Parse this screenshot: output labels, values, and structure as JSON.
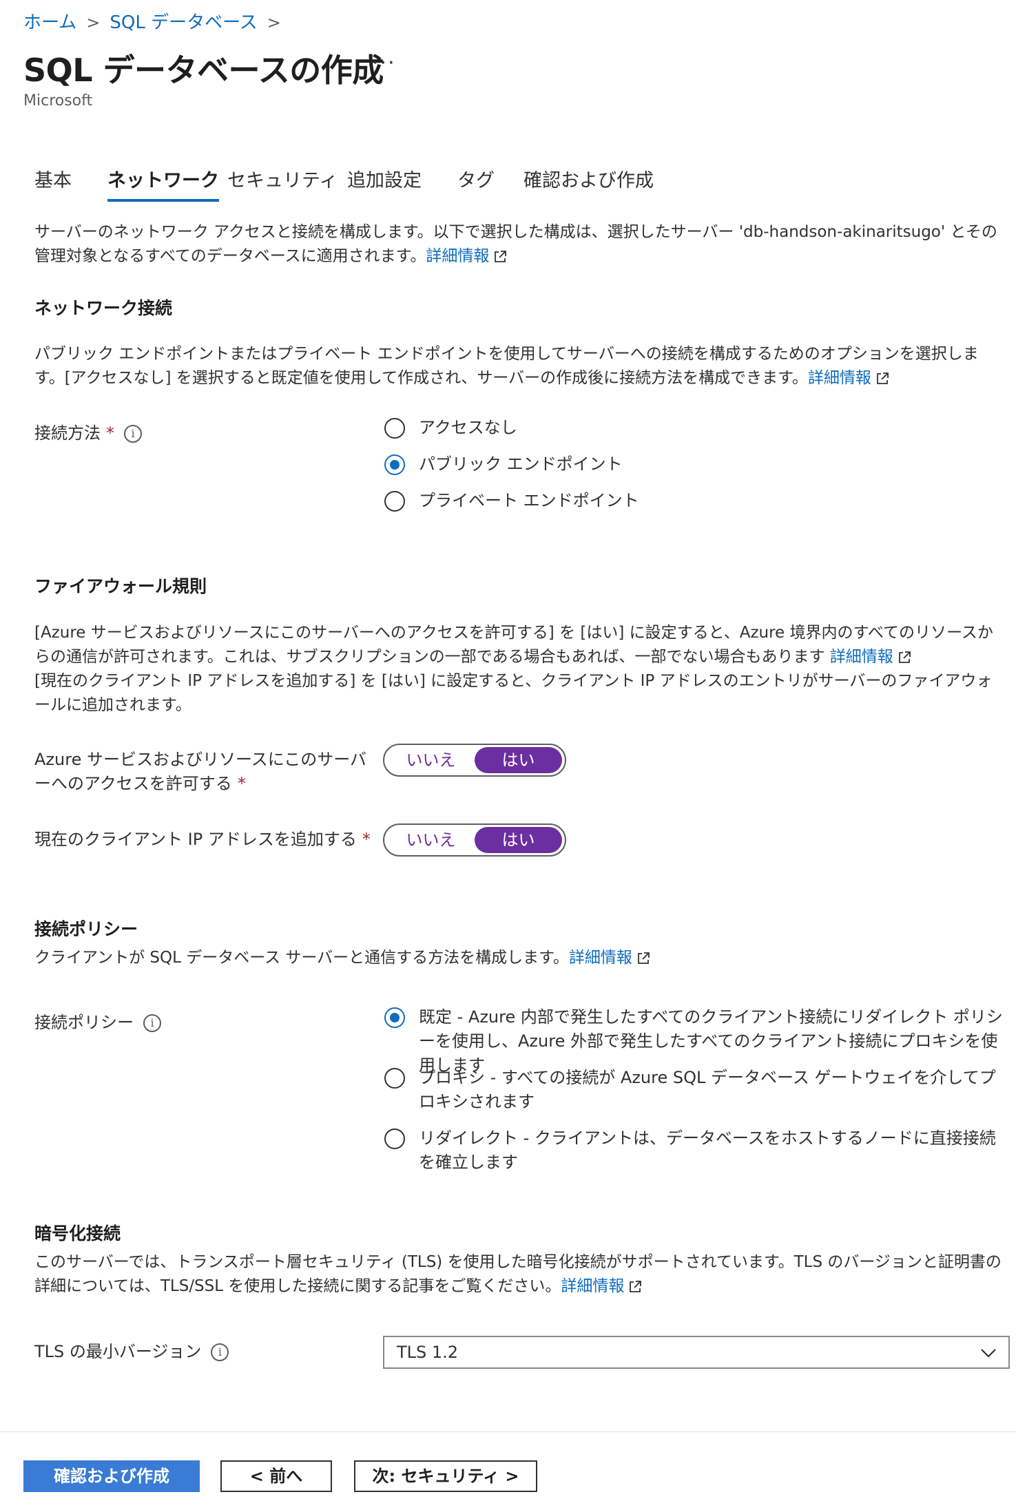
{
  "breadcrumb": {
    "home": "ホーム",
    "sep1": ">",
    "item2": "SQL データベース",
    "sep2": ">"
  },
  "page": {
    "title": "SQL データベースの作成",
    "more": "···",
    "subtitle": "Microsoft"
  },
  "tabs": [
    {
      "label": "基本"
    },
    {
      "label": "ネットワーク",
      "active": true
    },
    {
      "label": "セキュリティ"
    },
    {
      "label": "追加設定"
    },
    {
      "label": "タグ"
    },
    {
      "label": "確認および作成"
    }
  ],
  "intro": {
    "text": "サーバーのネットワーク アクセスと接続を構成します。以下で選択した構成は、選択したサーバー 'db-handson-akinaritsugo' とその管理対象となるすべてのデータベースに適用されます。",
    "link": "詳細情報"
  },
  "network": {
    "heading": "ネットワーク接続",
    "text": "パブリック エンドポイントまたはプライベート エンドポイントを使用してサーバーへの接続を構成するためのオプションを選択します。[アクセスなし] を選択すると既定値を使用して作成され、サーバーの作成後に接続方法を構成できます。",
    "link": "詳細情報",
    "method_label": "接続方法",
    "required_mark": "*",
    "info_icon": "i",
    "options": [
      {
        "label": "アクセスなし",
        "checked": false
      },
      {
        "label": "パブリック エンドポイント",
        "checked": true
      },
      {
        "label": "プライベート エンドポイント",
        "checked": false
      }
    ]
  },
  "firewall": {
    "heading": "ファイアウォール規則",
    "text1": "[Azure サービスおよびリソースにこのサーバーへのアクセスを許可する] を [はい] に設定すると、Azure 境界内のすべてのリソースからの通信が許可されます。これは、サブスクリプションの一部である場合もあれば、一部でない場合もあります",
    "link": "詳細情報",
    "text2": "[現在のクライアント IP アドレスを追加する] を [はい] に設定すると、クライアント IP アドレスのエントリがサーバーのファイアウォールに追加されます。",
    "allow_azure_label": "Azure サービスおよびリソースにこのサーバーへのアクセスを許可する",
    "add_ip_label": "現在のクライアント IP アドレスを追加する",
    "required_mark": "*",
    "no": "いいえ",
    "yes": "はい",
    "allow_azure_value": "はい",
    "add_ip_value": "はい"
  },
  "policy": {
    "heading": "接続ポリシー",
    "text": "クライアントが SQL データベース サーバーと通信する方法を構成します。",
    "link": "詳細情報",
    "label": "接続ポリシー",
    "info_icon": "i",
    "options": [
      {
        "label": "既定 - Azure 内部で発生したすべてのクライアント接続にリダイレクト ポリシーを使用し、Azure 外部で発生したすべてのクライアント接続にプロキシを使用します",
        "checked": true
      },
      {
        "label": "プロキシ - すべての接続が Azure SQL データベース ゲートウェイを介してプロキシされます",
        "checked": false
      },
      {
        "label": "リダイレクト - クライアントは、データベースをホストするノードに直接接続を確立します",
        "checked": false
      }
    ]
  },
  "encryption": {
    "heading": "暗号化接続",
    "text": "このサーバーでは、トランスポート層セキュリティ (TLS) を使用した暗号化接続がサポートされています。TLS のバージョンと証明書の詳細については、TLS/SSL を使用した接続に関する記事をご覧ください。",
    "link": "詳細情報",
    "tls_label": "TLS の最小バージョン",
    "info_icon": "i",
    "tls_value": "TLS 1.2"
  },
  "footer": {
    "review_create": "確認および作成",
    "prev": "< 前へ",
    "next": "次: セキュリティ >"
  },
  "colors": {
    "link": "#0f6cbd",
    "toggle_on": "#6b2fa0",
    "primary_button": "#3a7bd5",
    "required": "#a4262c"
  }
}
